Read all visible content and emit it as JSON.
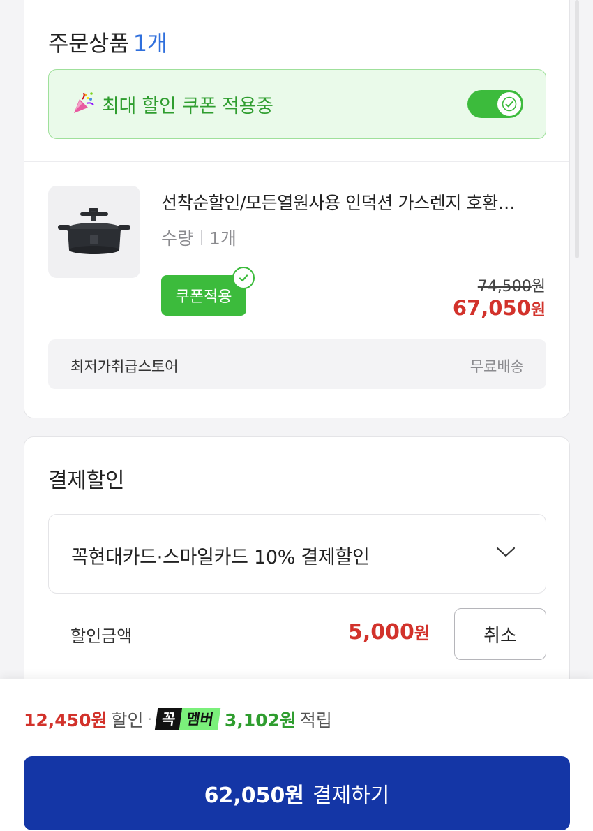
{
  "order": {
    "title": "주문상품",
    "count": "1개",
    "coupon_banner": {
      "icon": "party-popper-icon",
      "text": "최대 할인 쿠폰 적용중",
      "toggle_on": true
    },
    "product": {
      "name": "선착순할인/모든열원사용 인덕션 가스렌지 호환…",
      "qty_label": "수량",
      "qty_value": "1개",
      "coupon_badge": "쿠폰적용",
      "original_price": "74,500",
      "original_unit": "원",
      "sale_price": "67,050",
      "sale_unit": "원"
    },
    "store": {
      "name": "최저가취급스토어",
      "shipping": "무료배송"
    }
  },
  "payment_discount": {
    "title": "결제할인",
    "selected_card": "꼭현대카드·스마일카드 10% 결제할인",
    "discount_label": "할인금액",
    "discount_amount": "5,000",
    "discount_unit": "원",
    "cancel_label": "취소"
  },
  "summary": {
    "discount": "12,450원",
    "discount_suffix": "할인",
    "separator": "·",
    "member_badge_1": "꼭",
    "member_badge_2": "멤버",
    "points": "3,102원",
    "points_suffix": "적립"
  },
  "checkout": {
    "amount": "62,050원",
    "label": "결제하기"
  },
  "colors": {
    "accent_blue": "#1436a6",
    "sale_red": "#d2322b",
    "coupon_green": "#3cbb3c",
    "count_blue": "#2f6fdc"
  }
}
